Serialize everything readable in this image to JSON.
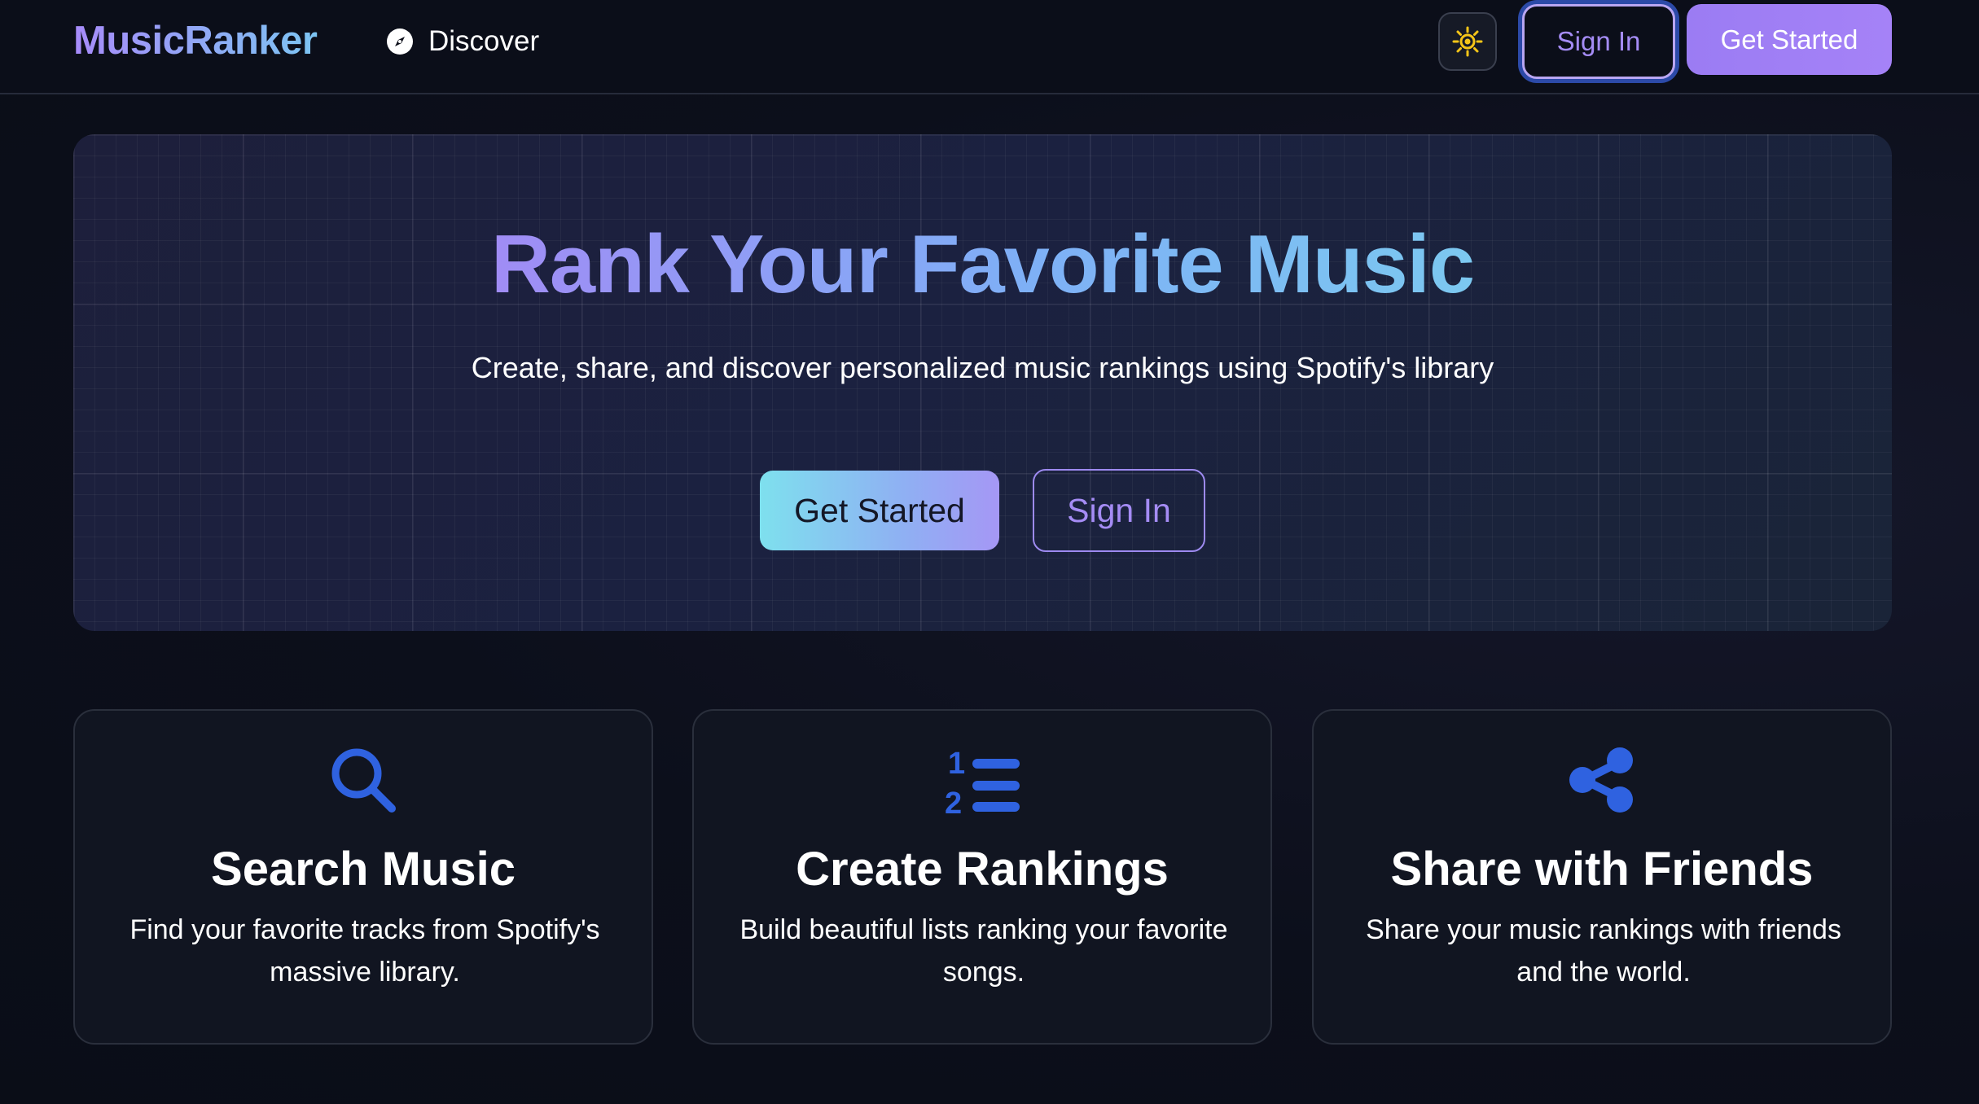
{
  "header": {
    "brand": "MusicRanker",
    "nav": {
      "discover_label": "Discover",
      "discover_icon": "compass-icon"
    },
    "theme_toggle_icon": "sun-icon",
    "sign_in_label": "Sign In",
    "get_started_label": "Get Started"
  },
  "hero": {
    "title": "Rank Your Favorite Music",
    "subtitle": "Create, share, and discover personalized music rankings using Spotify's library",
    "get_started_label": "Get Started",
    "sign_in_label": "Sign In"
  },
  "features": [
    {
      "icon": "search-icon",
      "title": "Search Music",
      "description": "Find your favorite tracks from Spotify's massive library."
    },
    {
      "icon": "numbered-list-icon",
      "title": "Create Rankings",
      "description": "Build beautiful lists ranking your favorite songs."
    },
    {
      "icon": "share-icon",
      "title": "Share with Friends",
      "description": "Share your music rankings with friends and the world."
    }
  ],
  "colors": {
    "accent_purple": "#a58cf5",
    "accent_cyan": "#7ee0ee",
    "icon_blue": "#2f62e0",
    "sun_yellow": "#f5c518",
    "background": "#0b0e19"
  }
}
